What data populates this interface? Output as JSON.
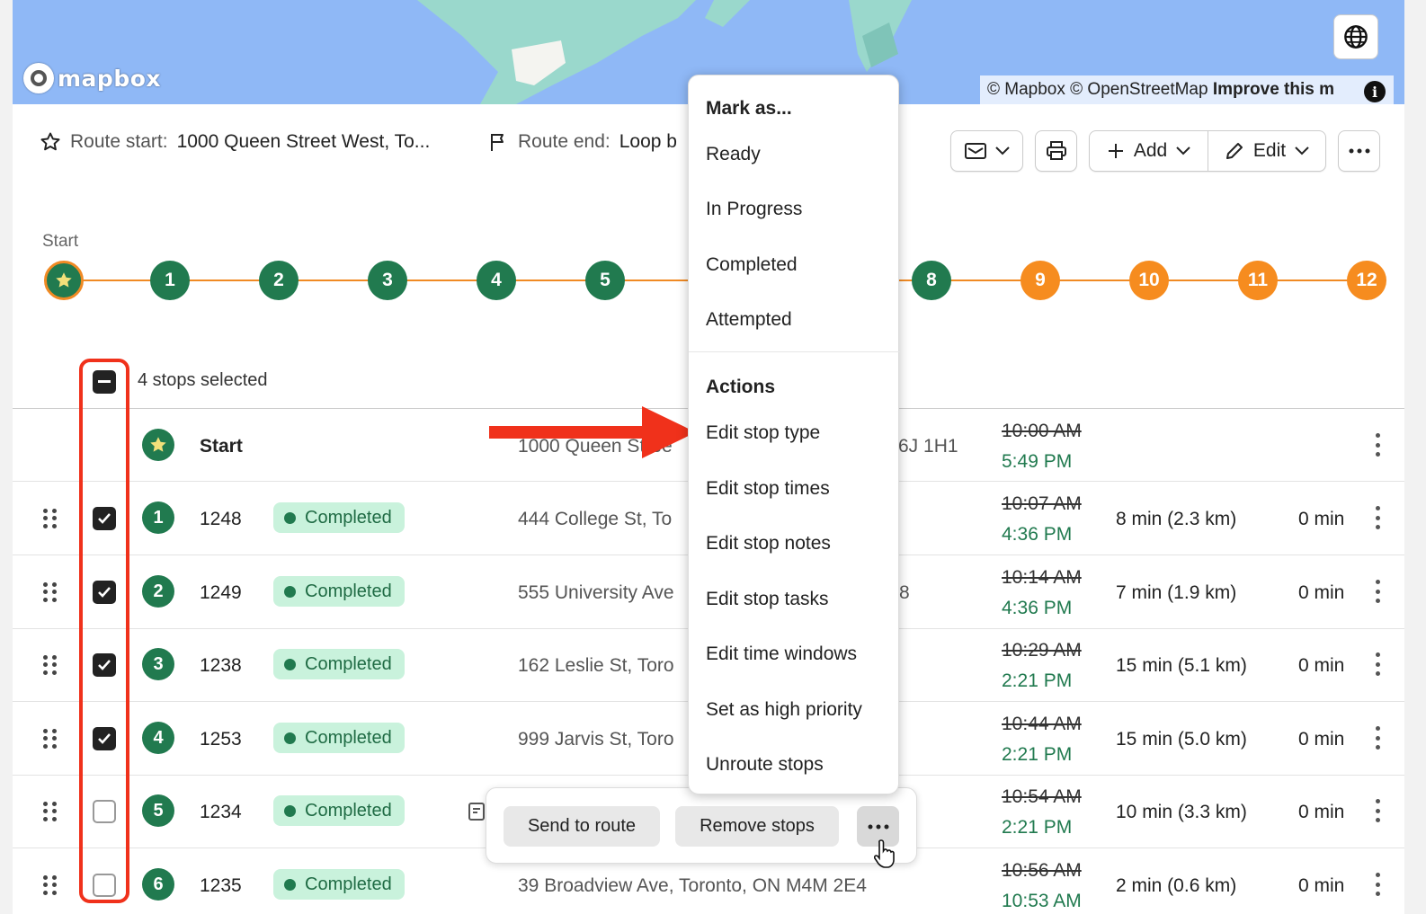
{
  "map": {
    "logo_text": "mapbox",
    "attribution": "© Mapbox © OpenStreetMap",
    "attribution_link": "Improve this m",
    "colors": {
      "water": "#8fb8f6",
      "park": "#9ad8cc"
    }
  },
  "route": {
    "start_label": "Route start:",
    "start_value": "1000 Queen Street West, To...",
    "end_label": "Route end:",
    "end_value": "Loop b"
  },
  "toolbar": {
    "add_label": "Add",
    "edit_label": "Edit"
  },
  "timeline": {
    "start_label": "Start",
    "stops": [
      "1",
      "2",
      "3",
      "4",
      "5",
      "8",
      "9",
      "10",
      "11",
      "12"
    ],
    "completed_color": "#217a4f",
    "pending_color": "#f68c1f"
  },
  "selection": {
    "count_text": "4 stops selected"
  },
  "start_row": {
    "label": "Start",
    "address": "1000 Queen Stree",
    "address_tail": "6J 1H1",
    "time_planned": "10:00 AM",
    "time_actual": "5:49 PM"
  },
  "rows": [
    {
      "num": "1",
      "id": "1248",
      "status": "Completed",
      "address": "444 College St, To",
      "tail": "",
      "planned": "10:07 AM",
      "actual": "4:36 PM",
      "drive": "8 min (2.3 km)",
      "wait": "0 min",
      "checked": true
    },
    {
      "num": "2",
      "id": "1249",
      "status": "Completed",
      "address": "555 University Ave",
      "tail": "8",
      "planned": "10:14 AM",
      "actual": "4:36 PM",
      "drive": "7 min (1.9 km)",
      "wait": "0 min",
      "checked": true
    },
    {
      "num": "3",
      "id": "1238",
      "status": "Completed",
      "address": "162 Leslie St, Toro",
      "tail": "",
      "planned": "10:29 AM",
      "actual": "2:21 PM",
      "drive": "15 min (5.1 km)",
      "wait": "0 min",
      "checked": true
    },
    {
      "num": "4",
      "id": "1253",
      "status": "Completed",
      "address": "999 Jarvis St, Toro",
      "tail": "",
      "planned": "10:44 AM",
      "actual": "2:21 PM",
      "drive": "15 min (5.0 km)",
      "wait": "0 min",
      "checked": true
    },
    {
      "num": "5",
      "id": "1234",
      "status": "Completed",
      "address": "",
      "tail": "",
      "planned": "10:54 AM",
      "actual": "2:21 PM",
      "drive": "10 min (3.3 km)",
      "wait": "0 min",
      "checked": false
    },
    {
      "num": "6",
      "id": "1235",
      "status": "Completed",
      "address": "39 Broadview Ave, Toronto, ON M4M 2E4",
      "tail": "",
      "planned": "10:56 AM",
      "actual": "10:53 AM",
      "drive": "2 min (0.6 km)",
      "wait": "0 min",
      "checked": false
    }
  ],
  "menu": {
    "mark_heading": "Mark as...",
    "mark_items": [
      "Ready",
      "In Progress",
      "Completed",
      "Attempted"
    ],
    "actions_heading": "Actions",
    "action_items": [
      "Edit stop type",
      "Edit stop times",
      "Edit stop notes",
      "Edit stop tasks",
      "Edit time windows",
      "Set as high priority",
      "Unroute stops"
    ]
  },
  "bulk_bar": {
    "send_label": "Send to route",
    "remove_label": "Remove stops",
    "more_label": "•••"
  },
  "annotation": {
    "highlight_color": "#f0311b"
  }
}
